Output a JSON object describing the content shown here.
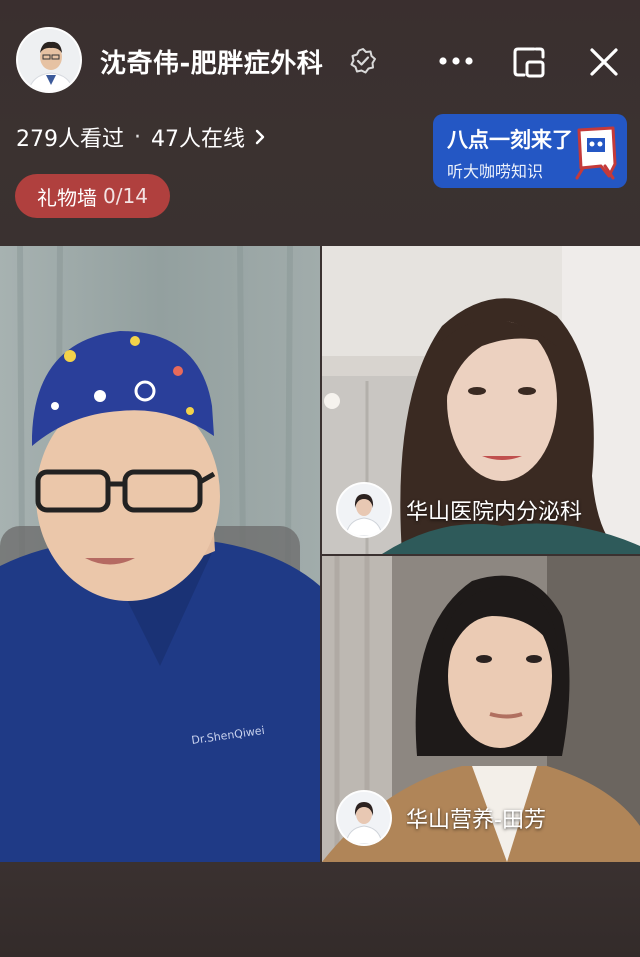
{
  "header": {
    "host_name": "沈奇伟-肥胖症外科",
    "icons": [
      "verified-badge-icon",
      "more-icon",
      "floating-window-icon",
      "close-icon"
    ]
  },
  "stats": {
    "viewed": "279人看过",
    "separator": "·",
    "online": "47人在线"
  },
  "gift_wall": {
    "label": "礼物墙",
    "count": "0/14"
  },
  "promo": {
    "title": "八点一刻来了",
    "subtitle": "听大咖唠知识",
    "background": "#2457c4"
  },
  "guests": [
    {
      "name": "华山医院内分泌科"
    },
    {
      "name": "华山营养-田芳"
    }
  ],
  "colors": {
    "background": "#3a3130",
    "gift_pill": "#b0403e",
    "promo": "#2457c4"
  }
}
